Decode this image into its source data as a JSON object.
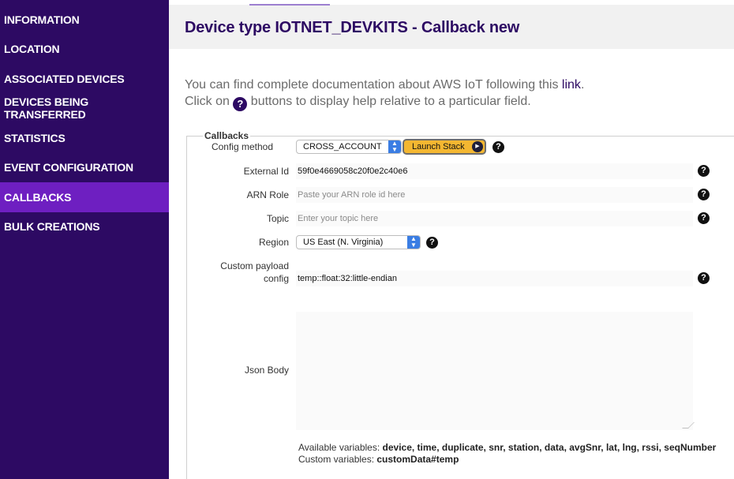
{
  "sidebar": {
    "items": [
      {
        "label": "INFORMATION",
        "active": false
      },
      {
        "label": "LOCATION",
        "active": false
      },
      {
        "label": "ASSOCIATED DEVICES",
        "active": false
      },
      {
        "label": "DEVICES BEING TRANSFERRED",
        "active": false
      },
      {
        "label": "STATISTICS",
        "active": false
      },
      {
        "label": "EVENT CONFIGURATION",
        "active": false
      },
      {
        "label": "CALLBACKS",
        "active": true
      },
      {
        "label": "BULK CREATIONS",
        "active": false
      }
    ]
  },
  "page": {
    "title": "Device type IOTNET_DEVKITS - Callback new",
    "intro_line1_prefix": "You can find complete documentation about AWS IoT following this ",
    "intro_link": "link",
    "intro_line1_suffix": ".",
    "intro_line2_prefix": "Click on ",
    "intro_help_glyph": "?",
    "intro_line2_suffix": " buttons to display help relative to a particular field."
  },
  "form": {
    "legend": "Callbacks",
    "config_method": {
      "label": "Config method",
      "value": "CROSS_ACCOUNT",
      "launch_label": "Launch Stack"
    },
    "external_id": {
      "label": "External Id",
      "value": "59f0e4669058c20f0e2c40e6"
    },
    "arn_role": {
      "label": "ARN Role",
      "placeholder": "Paste your ARN role id here"
    },
    "topic": {
      "label": "Topic",
      "placeholder": "Enter your topic here"
    },
    "region": {
      "label": "Region",
      "value": "US East (N. Virginia)"
    },
    "custom_payload": {
      "label_line1": "Custom payload",
      "label_line2": "config",
      "value": "temp::float:32:little-endian"
    },
    "json_body": {
      "label": "Json Body",
      "value": ""
    },
    "help_glyph": "?"
  },
  "variables": {
    "available_label": "Available variables: ",
    "available_list": "device, time, duplicate, snr, station, data, avgSnr, lat, lng, rssi, seqNumber",
    "custom_label": "Custom variables: ",
    "custom_list": "customData#temp"
  },
  "colors": {
    "sidebar_bg": "#2d0a63",
    "sidebar_active": "#6e1fc1",
    "title": "#2d0a63",
    "launch_button": "#f4b731",
    "select_chevron": "#3a7de3"
  }
}
